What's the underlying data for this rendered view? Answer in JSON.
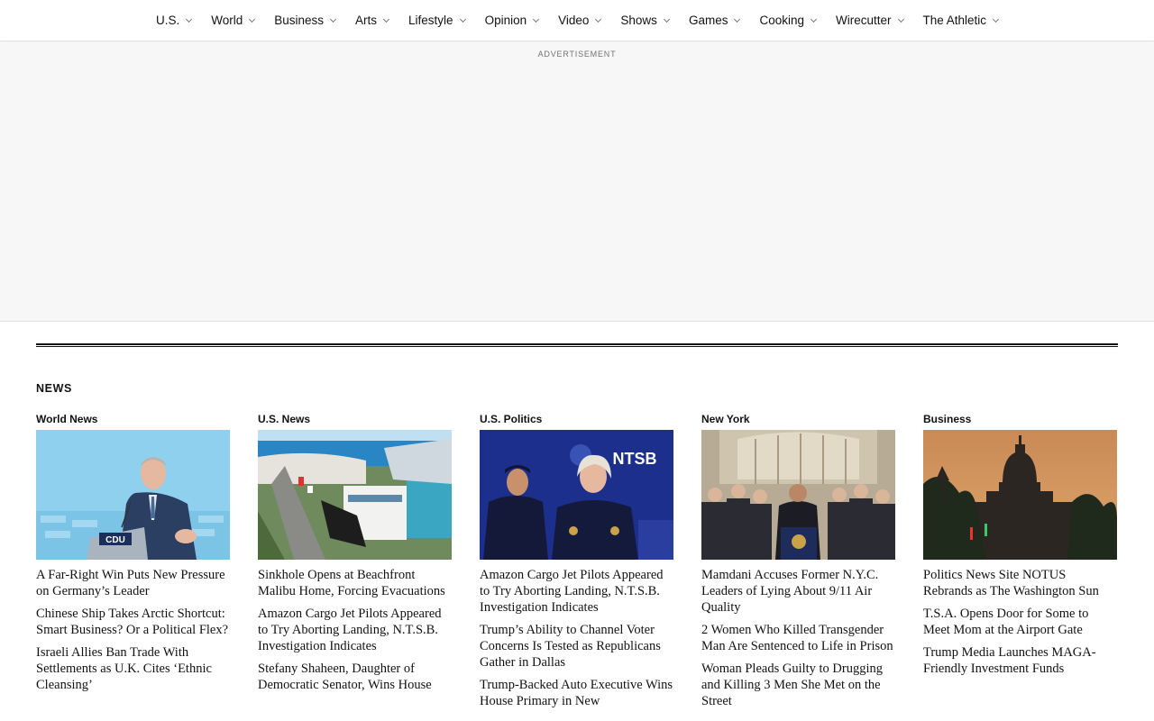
{
  "nav": {
    "items": [
      {
        "label": "U.S."
      },
      {
        "label": "World"
      },
      {
        "label": "Business"
      },
      {
        "label": "Arts"
      },
      {
        "label": "Lifestyle"
      },
      {
        "label": "Opinion"
      },
      {
        "label": "Video"
      },
      {
        "label": "Shows"
      },
      {
        "label": "Games"
      },
      {
        "label": "Cooking"
      },
      {
        "label": "Wirecutter"
      },
      {
        "label": "The Athletic"
      }
    ]
  },
  "ad": {
    "label": "ADVERTISEMENT"
  },
  "section": {
    "title": "NEWS"
  },
  "columns": [
    {
      "label": "World News",
      "headlines": [
        "A Far-Right Win Puts New Pressure on Germany’s Leader",
        "Chinese Ship Takes Arctic Shortcut: Smart Business? Or a Political Flex?",
        "Israeli Allies Ban Trade With Settlements as U.K. Cites ‘Ethnic Cleansing’"
      ]
    },
    {
      "label": "U.S. News",
      "headlines": [
        "Sinkhole Opens at Beachfront Malibu Home, Forcing Evacuations",
        "Amazon Cargo Jet Pilots Appeared to Try Aborting Landing, N.T.S.B. Investigation Indicates",
        "Stefany Shaheen, Daughter of Democratic Senator, Wins House"
      ]
    },
    {
      "label": "U.S. Politics",
      "headlines": [
        "Amazon Cargo Jet Pilots Appeared to Try Aborting Landing, N.T.S.B. Investigation Indicates",
        "Trump’s Ability to Channel Voter Concerns Is Tested as Republicans Gather in Dallas",
        "Trump-Backed Auto Executive Wins House Primary in New"
      ]
    },
    {
      "label": "New York",
      "headlines": [
        "Mamdani Accuses Former N.Y.C. Leaders of Lying About 9/11 Air Quality",
        "2 Women Who Killed Transgender Man Are Sentenced to Life in Prison",
        "Woman Pleads Guilty to Drugging and Killing 3 Men She Met on the Street"
      ]
    },
    {
      "label": "Business",
      "headlines": [
        "Politics News Site NOTUS Rebrands as The Washington Sun",
        "T.S.A. Opens Door for Some to Meet Mom at the Airport Gate",
        "Trump Media Launches MAGA-Friendly Investment Funds"
      ]
    }
  ],
  "images": {
    "cdu_logo_text": "CDU",
    "ntsb_text": "NTSB"
  }
}
